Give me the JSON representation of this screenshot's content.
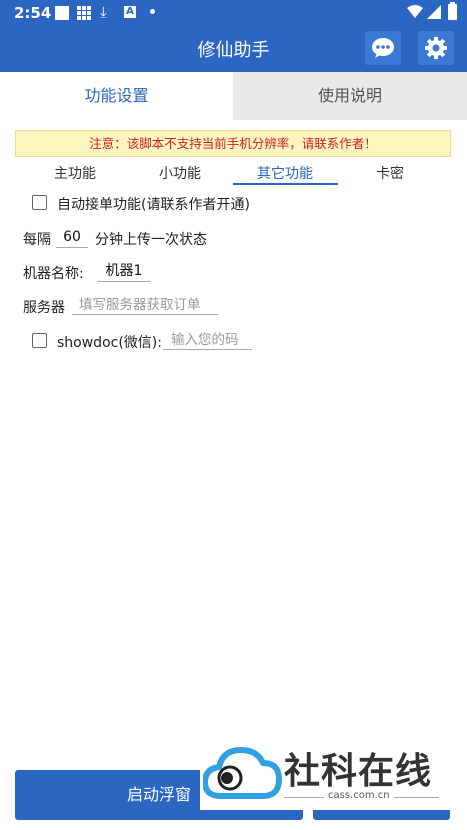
{
  "status_bar": {
    "time": "2:54",
    "a_glyph": "A"
  },
  "app": {
    "title": "修仙助手",
    "chat_icon": "chat-bubble-icon",
    "settings_icon": "gear-icon"
  },
  "tabs": [
    {
      "label": "功能设置",
      "active": true
    },
    {
      "label": "使用说明",
      "active": false
    }
  ],
  "notice": "注意：该脚本不支持当前手机分辨率，请联系作者！",
  "subtabs": [
    {
      "label": "主功能"
    },
    {
      "label": "小功能"
    },
    {
      "label": "其它功能",
      "active": true
    },
    {
      "label": "卡密"
    }
  ],
  "form": {
    "auto_accept": {
      "label": "自动接单功能(请联系作者开通)",
      "checked": false
    },
    "interval": {
      "prefix": "每隔",
      "value": "60",
      "suffix": "分钟上传一次状态"
    },
    "machine_name": {
      "label": "机器名称:",
      "value": "机器1"
    },
    "server": {
      "label": "服务器",
      "placeholder": "填写服务器获取订单"
    },
    "showdoc": {
      "label": "showdoc(微信):",
      "placeholder": "输入您的码",
      "checked": false
    }
  },
  "bottom": {
    "start_label": "启动浮窗"
  },
  "watermark": {
    "text": "社科在线",
    "domain": "cass.com.cn"
  },
  "colors": {
    "primary": "#2b66c2",
    "notice_bg": "#fdf5c0",
    "notice_text": "#cc2222",
    "inactive_tab_bg": "#e9e9e9"
  }
}
